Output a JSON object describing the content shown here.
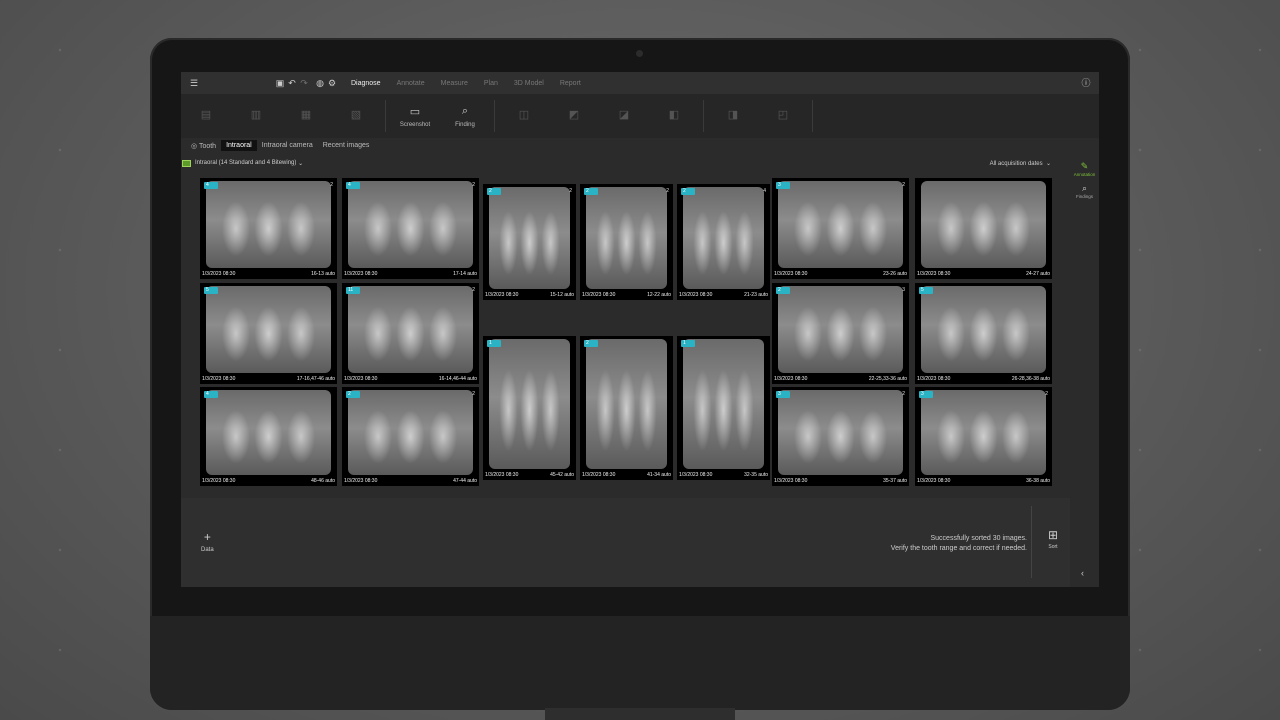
{
  "topbar": {
    "menu_icon": "hamburger-icon",
    "tabs": [
      {
        "label": "Diagnose",
        "active": true
      },
      {
        "label": "Annotate",
        "active": false
      },
      {
        "label": "Measure",
        "active": false
      },
      {
        "label": "Plan",
        "active": false
      },
      {
        "label": "3D Model",
        "active": false
      },
      {
        "label": "Report",
        "active": false
      }
    ],
    "help_icon": "help-icon"
  },
  "ribbon": {
    "screenshot_label": "Screenshot",
    "finding_label": "Finding"
  },
  "view_tabs": [
    {
      "label": "Tooth",
      "active": false
    },
    {
      "label": "Intraoral",
      "active": true
    },
    {
      "label": "Intraoral camera",
      "active": false
    },
    {
      "label": "Recent images",
      "active": false
    }
  ],
  "filter": {
    "selection_label": "Intraoral (14 Standard and 4 Bitewing)",
    "acquisition_label": "All acquisition dates"
  },
  "images": [
    {
      "tag": "4",
      "count": "2",
      "date": "1/3/2023 08:30",
      "range": "16-13 auto"
    },
    {
      "tag": "4",
      "count": "2",
      "date": "1/3/2023 08:30",
      "range": "17-14 auto"
    },
    {
      "tag": "2",
      "count": "2",
      "date": "1/3/2023 08:30",
      "range": "15-12 auto"
    },
    {
      "tag": "2",
      "count": "2",
      "date": "1/3/2023 08:30",
      "range": "12-22 auto"
    },
    {
      "tag": "2",
      "count": "4",
      "date": "1/3/2023 08:30",
      "range": "21-23 auto"
    },
    {
      "tag": "3",
      "count": "2",
      "date": "1/3/2023 08:30",
      "range": "23-26 auto"
    },
    {
      "tag": "",
      "count": "",
      "date": "1/3/2023 08:30",
      "range": "24-27 auto"
    },
    {
      "tag": "5",
      "count": "",
      "date": "1/3/2023 08:30",
      "range": "17-16,47-46 auto"
    },
    {
      "tag": "11",
      "count": "2",
      "date": "1/3/2023 08:30",
      "range": "16-14,46-44 auto"
    },
    {
      "tag": "2",
      "count": "3",
      "date": "1/3/2023 08:30",
      "range": "22-25,33-36 auto"
    },
    {
      "tag": "5",
      "count": "",
      "date": "1/3/2023 08:30",
      "range": "26-28,36-38 auto"
    },
    {
      "tag": "1",
      "count": "",
      "date": "1/3/2023 08:30",
      "range": "45-42 auto"
    },
    {
      "tag": "2",
      "count": "",
      "date": "1/3/2023 08:30",
      "range": "41-34 auto"
    },
    {
      "tag": "1",
      "count": "",
      "date": "1/3/2023 08:30",
      "range": "32-35 auto"
    },
    {
      "tag": "4",
      "count": "",
      "date": "1/3/2023 08:30",
      "range": "48-46 auto"
    },
    {
      "tag": "2",
      "count": "2",
      "date": "1/3/2023 08:30",
      "range": "47-44 auto"
    },
    {
      "tag": "3",
      "count": "2",
      "date": "1/3/2023 08:30",
      "range": "35-37 auto"
    },
    {
      "tag": "3",
      "count": "2",
      "date": "1/3/2023 08:30",
      "range": "36-38 auto"
    }
  ],
  "side_panel": {
    "annotation_label": "Annotation",
    "findings_label": "Findings"
  },
  "bottom": {
    "add_label": "Data",
    "message_line1": "Successfully sorted 30 images.",
    "message_line2": "Verify the tooth range and correct if needed.",
    "sort_label": "Sort"
  },
  "colors": {
    "accent_tag": "#2ab3c4",
    "active_green": "#7ec33a"
  }
}
